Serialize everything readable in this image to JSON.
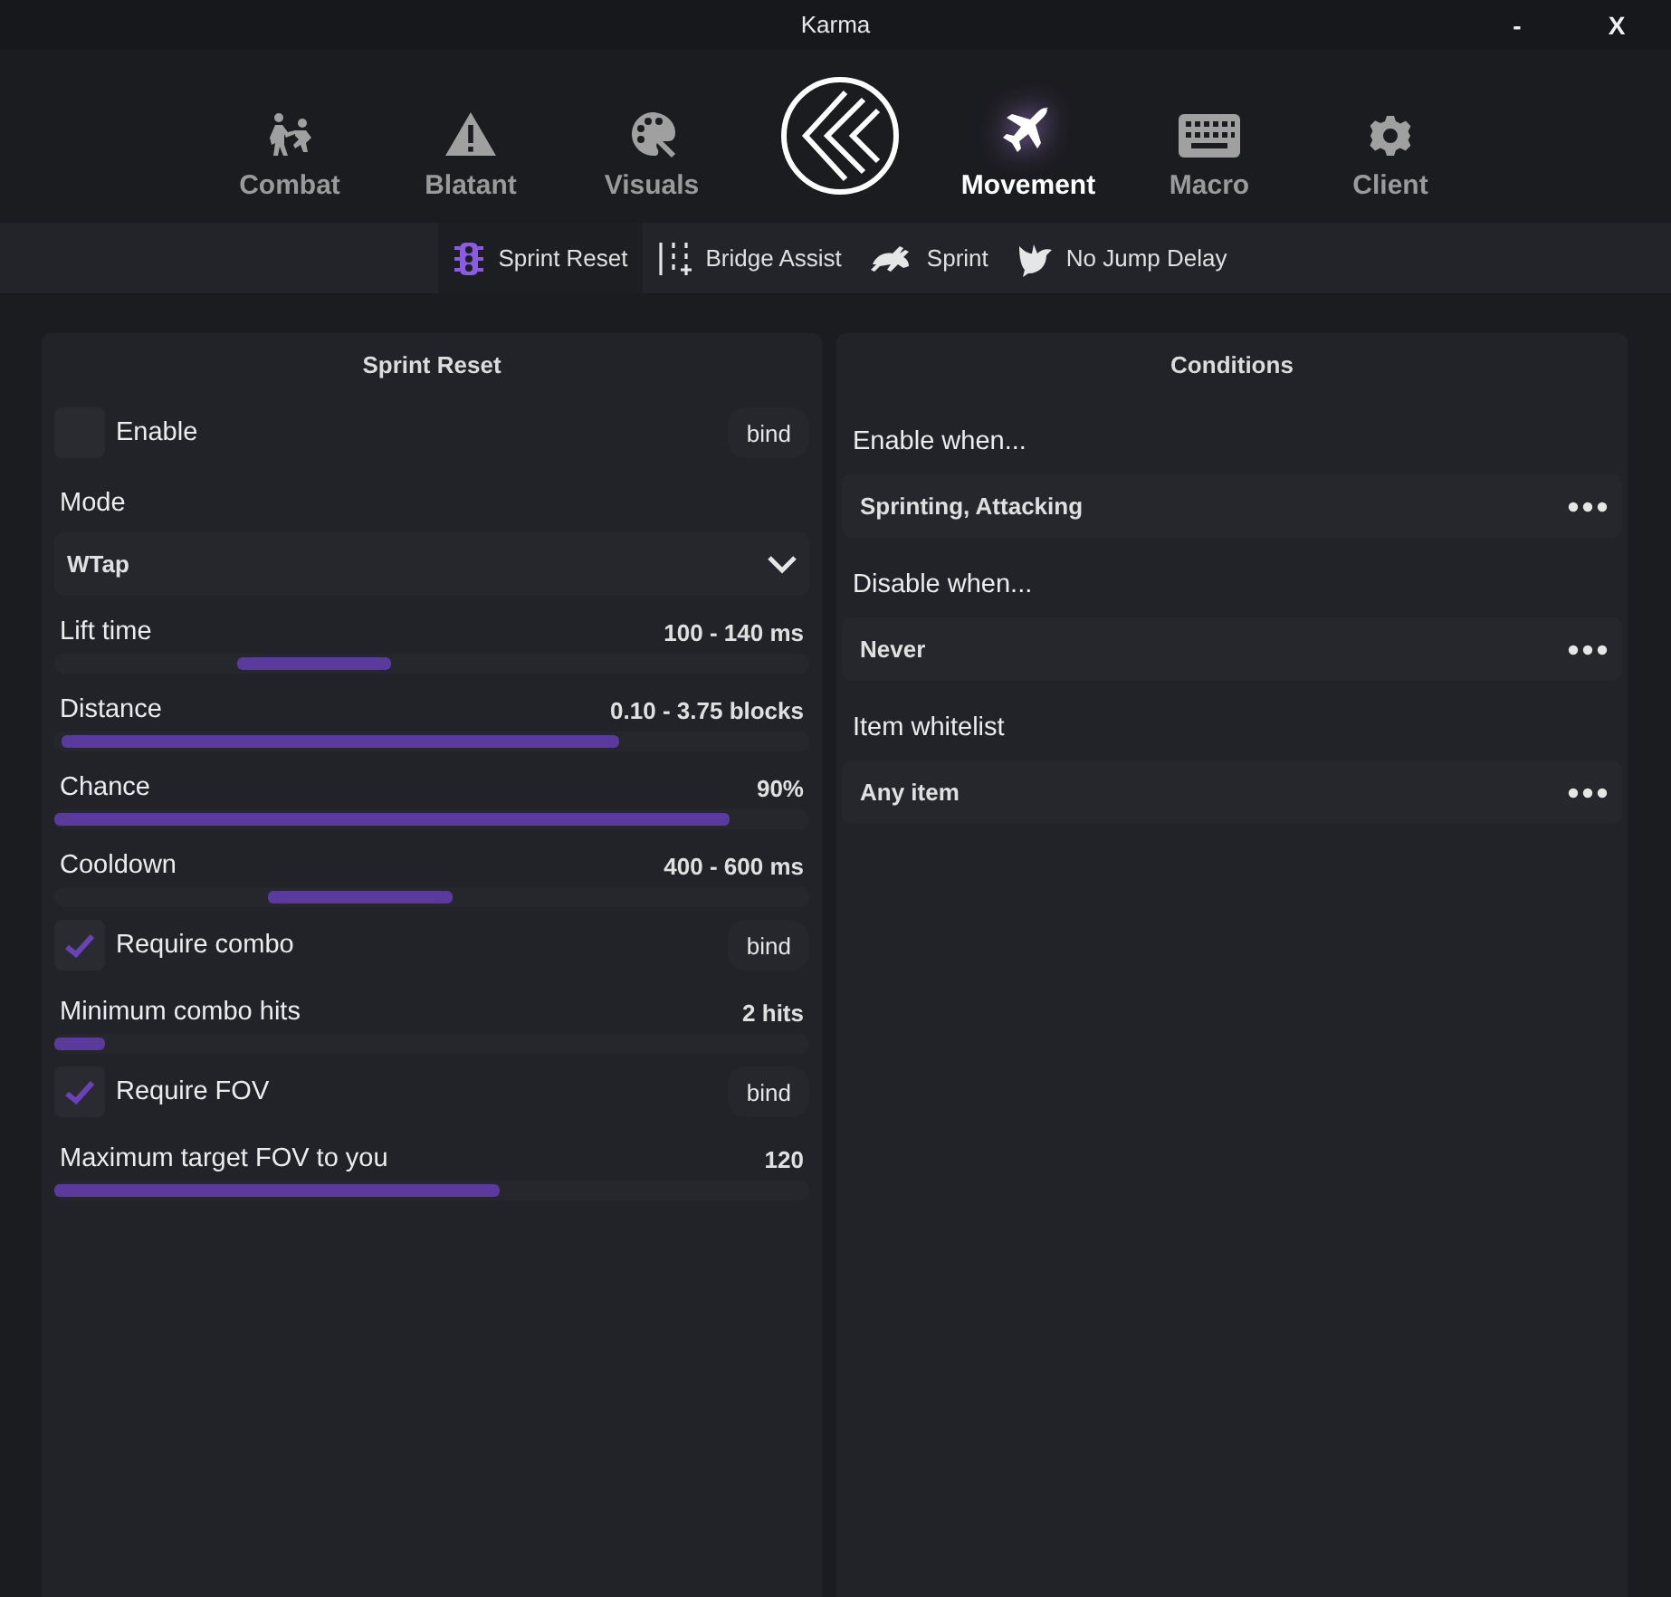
{
  "window": {
    "title": "Karma",
    "minimize": "-",
    "close": "X"
  },
  "nav": [
    {
      "label": "Combat",
      "selected": false
    },
    {
      "label": "Blatant",
      "selected": false
    },
    {
      "label": "Visuals",
      "selected": false
    },
    {
      "label": "Movement",
      "selected": true
    },
    {
      "label": "Macro",
      "selected": false
    },
    {
      "label": "Client",
      "selected": false
    }
  ],
  "subtabs": [
    {
      "label": "Sprint Reset",
      "selected": true
    },
    {
      "label": "Bridge Assist",
      "selected": false
    },
    {
      "label": "Sprint",
      "selected": false
    },
    {
      "label": "No Jump Delay",
      "selected": false
    }
  ],
  "settings": {
    "title": "Sprint Reset",
    "items": [
      {
        "kind": "toggle",
        "label": "Enable",
        "checked": false,
        "bind": "bind"
      },
      {
        "kind": "dropdown",
        "label": "Mode",
        "value": "WTap"
      },
      {
        "kind": "range",
        "label": "Lift time",
        "reading": "100 - 140 ms",
        "low": {
          "level": 0.25
        },
        "high": {
          "level": 0.44
        }
      },
      {
        "kind": "range",
        "label": "Distance",
        "reading": "0.10 - 3.75 blocks",
        "low": {
          "level": 0.017
        },
        "high": {
          "level": 0.74
        }
      },
      {
        "kind": "slider",
        "label": "Chance",
        "reading": "90%",
        "level": 0.895
      },
      {
        "kind": "range",
        "label": "Cooldown",
        "reading": "400 - 600 ms",
        "low": {
          "level": 0.29
        },
        "high": {
          "level": 0.52
        }
      },
      {
        "kind": "toggle",
        "label": "Require combo",
        "checked": true,
        "bind": "bind"
      },
      {
        "kind": "slider",
        "label": "Minimum combo hits",
        "reading": "2 hits",
        "level": 0.067
      },
      {
        "kind": "toggle",
        "label": "Require FOV",
        "checked": true,
        "bind": "bind"
      },
      {
        "kind": "slider",
        "label": "Maximum target FOV to you",
        "reading": "120",
        "level": 0.59
      }
    ]
  },
  "conditions": {
    "title": "Conditions",
    "items": [
      {
        "label": "Enable when...",
        "value": "Sprinting, Attacking"
      },
      {
        "label": "Disable when...",
        "value": "Never"
      },
      {
        "label": "Item whitelist",
        "value": "Any item"
      }
    ]
  }
}
